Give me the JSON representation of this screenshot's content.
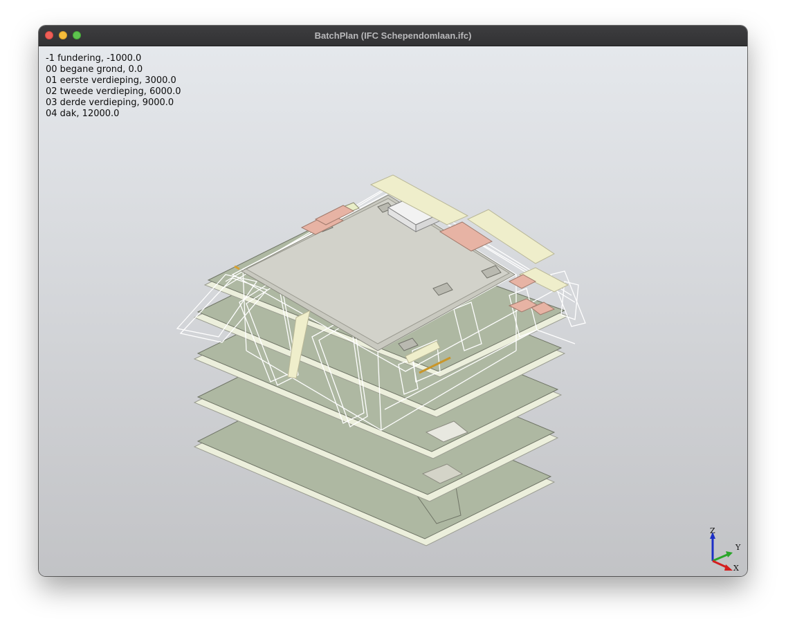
{
  "window": {
    "title": "BatchPlan (IFC Schependomlaan.ifc)"
  },
  "storeys": [
    "-1 fundering, -1000.0",
    "00 begane grond, 0.0",
    "01 eerste verdieping, 3000.0",
    "02 tweede verdieping, 6000.0",
    "03 derde verdieping, 9000.0",
    "04 dak, 12000.0"
  ],
  "axes": {
    "z": "Z",
    "y": "Y",
    "x": "X"
  },
  "colors": {
    "slab": "#aeb8a2",
    "slab_edge": "#e9ecd9",
    "roof": "#cfcfc6",
    "wall_outline": "#ffffff",
    "pink_element": "#e7b3a4",
    "yellow_element": "#efeecb",
    "axis_x": "#d41f1f",
    "axis_y": "#2aa52a",
    "axis_z": "#1c2fc6"
  }
}
